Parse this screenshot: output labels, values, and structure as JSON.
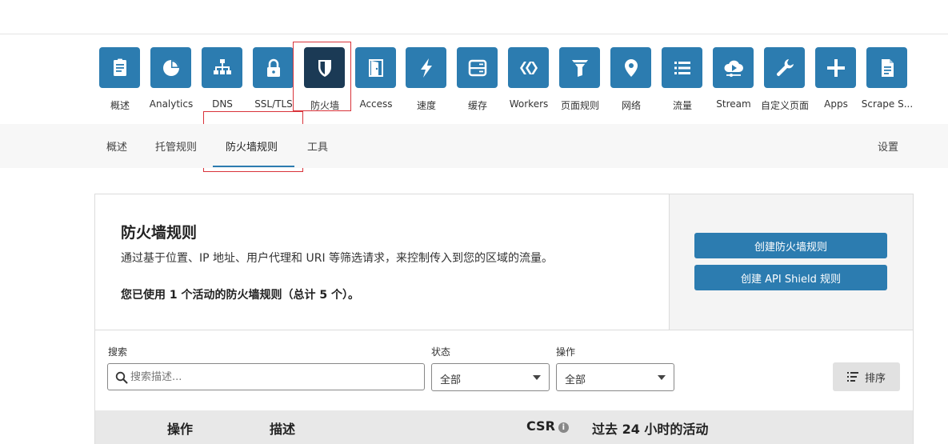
{
  "nav": {
    "items": [
      {
        "label": "概述",
        "icon": "document-icon"
      },
      {
        "label": "Analytics",
        "icon": "pie-chart-icon"
      },
      {
        "label": "DNS",
        "icon": "network-tree-icon"
      },
      {
        "label": "SSL/TLS",
        "icon": "lock-icon"
      },
      {
        "label": "防火墙",
        "icon": "shield-icon"
      },
      {
        "label": "Access",
        "icon": "door-icon"
      },
      {
        "label": "速度",
        "icon": "lightning-icon"
      },
      {
        "label": "缓存",
        "icon": "server-icon"
      },
      {
        "label": "Workers",
        "icon": "workers-icon"
      },
      {
        "label": "页面规则",
        "icon": "filter-icon"
      },
      {
        "label": "网络",
        "icon": "location-pin-icon"
      },
      {
        "label": "流量",
        "icon": "list-icon"
      },
      {
        "label": "Stream",
        "icon": "cloud-play-icon"
      },
      {
        "label": "自定义页面",
        "icon": "wrench-icon"
      },
      {
        "label": "Apps",
        "icon": "plus-icon"
      },
      {
        "label": "Scrape S...",
        "icon": "page-icon"
      }
    ],
    "active_label": "防火墙"
  },
  "subnav": {
    "tabs": [
      "概述",
      "托管规则",
      "防火墙规则",
      "工具"
    ],
    "active": "防火墙规则",
    "settings": "设置"
  },
  "card": {
    "title": "防火墙规则",
    "description": "通过基于位置、IP 地址、用户代理和 URI 等筛选请求，来控制传入到您的区域的流量。",
    "usage": "您已使用 1 个活动的防火墙规则（总计 5 个）。",
    "create_button": "创建防火墙规则",
    "create_api_button": "创建 API Shield 规则"
  },
  "filters": {
    "search_label": "搜索",
    "search_placeholder": "搜索描述...",
    "status_label": "状态",
    "status_value": "全部",
    "action_label": "操作",
    "action_value": "全部",
    "sort_label": "排序"
  },
  "table": {
    "headers": [
      "操作",
      "描述",
      "CSR",
      "过去 24 小时的活动"
    ]
  },
  "colors": {
    "accent": "#2c7cb0",
    "active_tile": "#1b3a55",
    "highlight_box": "#d9333a"
  }
}
